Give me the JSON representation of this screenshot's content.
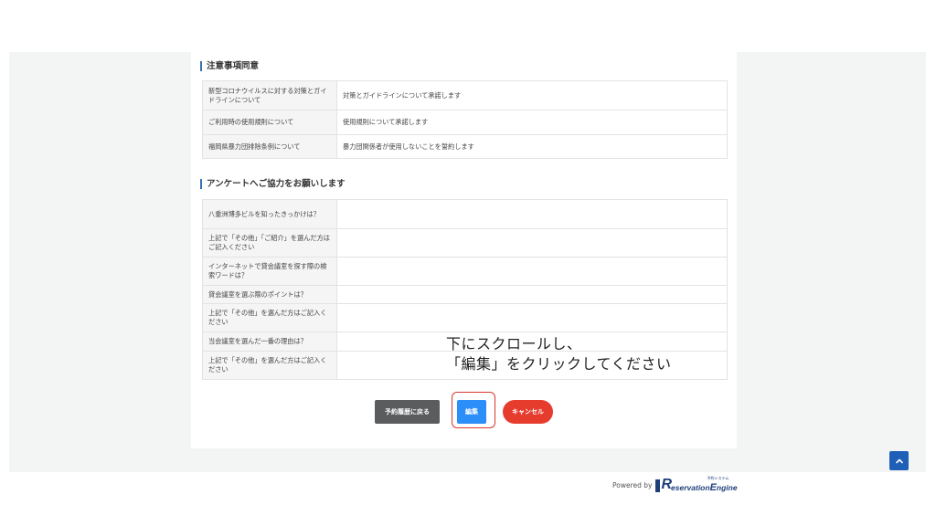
{
  "sections": {
    "agreement": {
      "title": "注意事項同意",
      "rows": [
        {
          "label": "新型コロナウイルスに対する対策とガイドラインについて",
          "value": "対策とガイドラインについて承諾します"
        },
        {
          "label": "ご利用時の使用規則について",
          "value": "使用規則について承諾します"
        },
        {
          "label": "福岡県暴力団排除条例について",
          "value": "暴力団関係者が使用しないことを誓約します"
        }
      ]
    },
    "survey": {
      "title": "アンケートへご協力をお願いします",
      "rows": [
        {
          "label": "八重洲博多ビルを知ったきっかけは？",
          "value": ""
        },
        {
          "label": "上記で「その他」「ご紹介」を選んだ方はご記入ください",
          "value": ""
        },
        {
          "label": "インターネットで貸会議室を探す際の検索ワードは？",
          "value": ""
        },
        {
          "label": "貸会議室を選ぶ際のポイントは？",
          "value": ""
        },
        {
          "label": "上記で「その他」を選んだ方はご記入ください",
          "value": ""
        },
        {
          "label": "当会議室を選んだ一番の理由は？",
          "value": ""
        },
        {
          "label": "上記で「その他」を選んだ方はご記入ください",
          "value": ""
        }
      ]
    }
  },
  "buttons": {
    "back": "予約履歴に戻る",
    "edit": "編集",
    "cancel": "キャンセル"
  },
  "instruction": {
    "line1": "下にスクロールし、",
    "line2": "「編集」をクリックしてください"
  },
  "footer": {
    "powered_by": "Powered by",
    "logo_sub": "予約システム",
    "logo_mark": "R",
    "logo_word1": "eservation",
    "logo_word2_initial": "E",
    "logo_word2": "ngine"
  },
  "icons": {
    "scroll_top": "chevron-up-icon"
  },
  "colors": {
    "edit_button": "#2c8ef8",
    "cancel_button": "#e53c2e",
    "back_button": "#5a5c5e",
    "highlight": "#d9382b",
    "scroll_top": "#1f5fb8"
  }
}
